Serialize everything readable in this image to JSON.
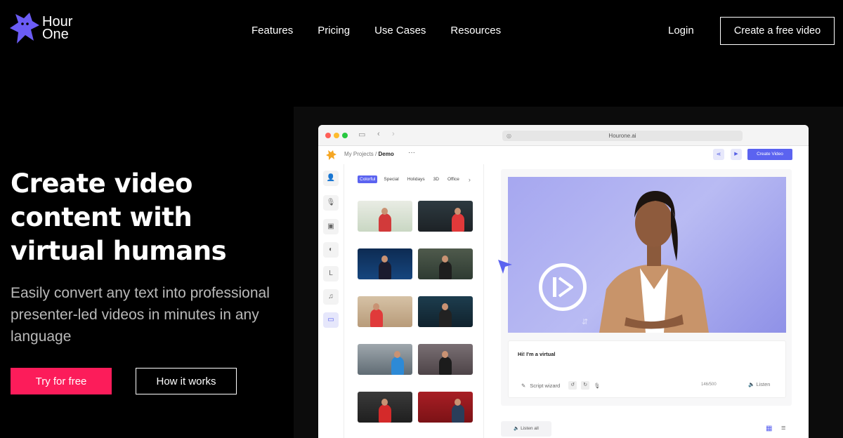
{
  "brand": {
    "name": "Hour One",
    "line1": "Hour",
    "line2": "One",
    "accent": "#6b5cf5"
  },
  "nav": {
    "links": [
      "Features",
      "Pricing",
      "Use Cases",
      "Resources"
    ],
    "login": "Login",
    "cta": "Create a free video"
  },
  "hero": {
    "title": "Create video content with virtual humans",
    "subtitle": "Easily convert any text into professional presenter-led videos in minutes in any language",
    "primary_button": "Try for free",
    "secondary_button": "How it works",
    "primary_color": "#fc1c5a"
  },
  "app": {
    "url": "Hourone.ai",
    "breadcrumb_parent": "My Projects",
    "breadcrumb_sep": "/",
    "breadcrumb_current": "Demo",
    "more": "···",
    "create_button": "Create Video",
    "categories": [
      "Colorful",
      "Special",
      "Holidays",
      "3D",
      "Office"
    ],
    "active_category": "Colorful",
    "sidebar_icons": [
      "user-icon",
      "microphone-icon",
      "image-icon",
      "palette-icon",
      "text-icon",
      "music-icon",
      "layout-icon"
    ],
    "sidebar_glyphs": [
      "👤",
      "🎙",
      "▣",
      "◐",
      "L",
      "♫",
      "▭"
    ],
    "script_text": "Hi! I'm a virtual",
    "script_wizard": "Script wizard",
    "char_count": "146/500",
    "listen": "Listen",
    "listen_all": "Listen all"
  }
}
